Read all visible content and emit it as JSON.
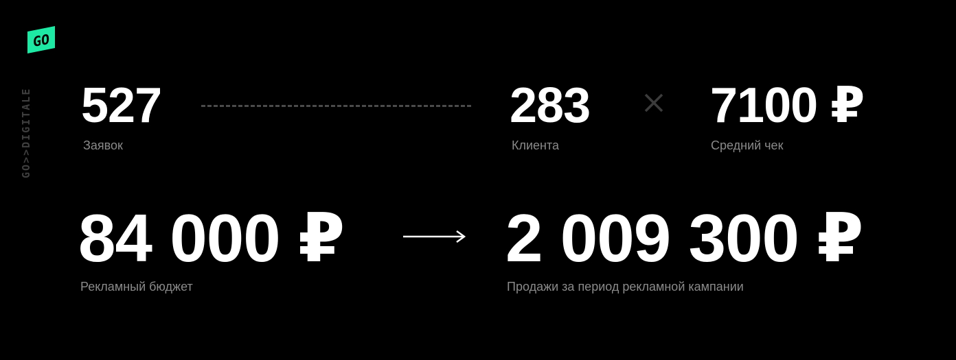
{
  "brand": {
    "logo_mark": "GO",
    "logo_text": "GO>>DIGITALE",
    "accent_color": "#1de9a4"
  },
  "funnel": {
    "requests": {
      "value": "527",
      "label": "Заявок"
    },
    "clients": {
      "value": "283",
      "label": "Клиента"
    },
    "avg_check": {
      "value": "7100 ₽",
      "label": "Средний чек"
    },
    "multiply_icon": "times-icon"
  },
  "result": {
    "budget": {
      "value": "84 000 ₽",
      "label": "Рекламный бюджет"
    },
    "arrow_icon": "arrow-right-icon",
    "sales": {
      "value": "2 009 300 ₽",
      "label": "Продажи за период рекламной кампании"
    }
  }
}
